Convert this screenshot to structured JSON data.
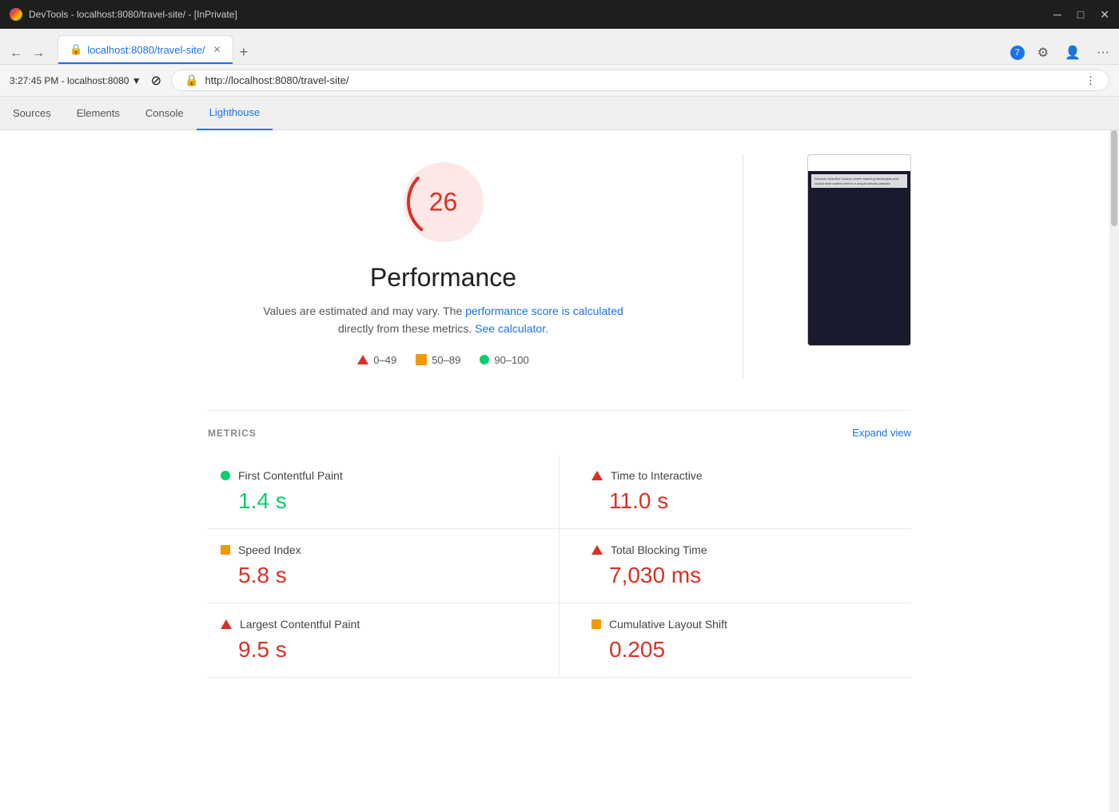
{
  "titleBar": {
    "title": "DevTools - localhost:8080/travel-site/ - [InPrivate]",
    "minimize": "─",
    "maximize": "□",
    "close": "✕"
  },
  "addressBar": {
    "time": "3:27:45 PM",
    "host": "localhost:8080",
    "url": "http://localhost:8080/travel-site/",
    "reload_label": "⊘"
  },
  "devtoolsTabs": [
    {
      "label": "Sources",
      "active": false
    },
    {
      "label": "Elements",
      "active": false
    },
    {
      "label": "Console",
      "active": false
    },
    {
      "label": "Lighthouse",
      "active": true
    }
  ],
  "notification": {
    "count": "7"
  },
  "tabBar": {
    "add_tab": "+",
    "new_tab": "+",
    "more": "···"
  },
  "lighthouse": {
    "score": "26",
    "performance_title": "Performance",
    "description_part1": "Values are estimated and may vary. The ",
    "description_link1": "performance score is calculated",
    "description_part2": " directly from these metrics. ",
    "description_link2": "See calculator.",
    "legend": {
      "bad_range": "0–49",
      "medium_range": "50–89",
      "good_range": "90–100"
    },
    "metrics_label": "METRICS",
    "expand_view": "Expand view",
    "metrics": [
      {
        "name": "First Contentful Paint",
        "value": "1.4 s",
        "status": "good"
      },
      {
        "name": "Time to Interactive",
        "value": "11.0 s",
        "status": "bad"
      },
      {
        "name": "Speed Index",
        "value": "5.8 s",
        "status": "medium"
      },
      {
        "name": "Total Blocking Time",
        "value": "7,030 ms",
        "status": "bad"
      },
      {
        "name": "Largest Contentful Paint",
        "value": "9.5 s",
        "status": "bad"
      },
      {
        "name": "Cumulative Layout Shift",
        "value": "0.205",
        "status": "medium"
      }
    ]
  }
}
